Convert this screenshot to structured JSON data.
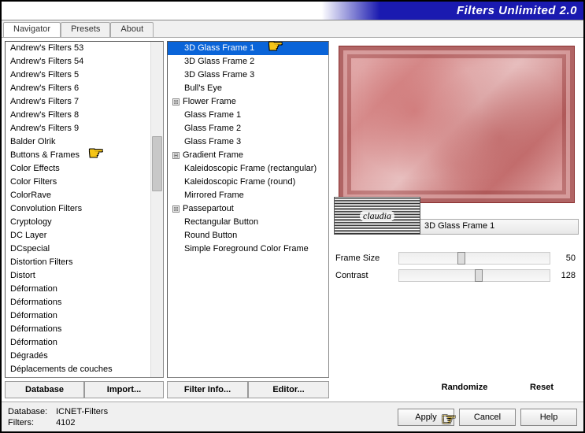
{
  "title": "Filters Unlimited 2.0",
  "tabs": {
    "navigator": "Navigator",
    "presets": "Presets",
    "about": "About"
  },
  "categories": [
    "Andrew's Filters 53",
    "Andrew's Filters 54",
    "Andrew's Filters 5",
    "Andrew's Filters 6",
    "Andrew's Filters 7",
    "Andrew's Filters 8",
    "Andrew's Filters 9",
    "Balder Olrik",
    "Buttons & Frames",
    "Color Effects",
    "Color Filters",
    "ColorRave",
    "Convolution Filters",
    "Cryptology",
    "DC Layer",
    "DCspecial",
    "Distortion Filters",
    "Distort",
    "Déformation",
    "Déformations",
    "Déformation",
    "Déformations",
    "Déformation",
    "Dégradés",
    "Déplacements de couches"
  ],
  "filters": [
    {
      "name": "3D Glass Frame 1",
      "exp": false,
      "sel": true
    },
    {
      "name": "3D Glass Frame 2",
      "exp": false
    },
    {
      "name": "3D Glass Frame 3",
      "exp": false
    },
    {
      "name": "Bull's Eye",
      "exp": false
    },
    {
      "name": "Flower Frame",
      "exp": true
    },
    {
      "name": "Glass Frame 1",
      "exp": false
    },
    {
      "name": "Glass Frame 2",
      "exp": false
    },
    {
      "name": "Glass Frame 3",
      "exp": false
    },
    {
      "name": "Gradient Frame",
      "exp": true
    },
    {
      "name": "Kaleidoscopic Frame (rectangular)",
      "exp": false
    },
    {
      "name": "Kaleidoscopic Frame (round)",
      "exp": false
    },
    {
      "name": "Mirrored Frame",
      "exp": false
    },
    {
      "name": "Passepartout",
      "exp": true
    },
    {
      "name": "Rectangular Button",
      "exp": false
    },
    {
      "name": "Round Button",
      "exp": false
    },
    {
      "name": "Simple Foreground Color Frame",
      "exp": false
    }
  ],
  "buttons": {
    "database": "Database",
    "import": "Import...",
    "filterinfo": "Filter Info...",
    "editor": "Editor...",
    "randomize": "Randomize",
    "reset": "Reset",
    "apply": "Apply",
    "cancel": "Cancel",
    "help": "Help"
  },
  "selected_filter": "3D Glass Frame 1",
  "params": [
    {
      "label": "Frame Size",
      "value": 50,
      "pct": 39
    },
    {
      "label": "Contrast",
      "value": 128,
      "pct": 50
    }
  ],
  "status": {
    "db_label": "Database:",
    "db_value": "ICNET-Filters",
    "filters_label": "Filters:",
    "filters_value": "4102"
  },
  "watermark": "claudia"
}
